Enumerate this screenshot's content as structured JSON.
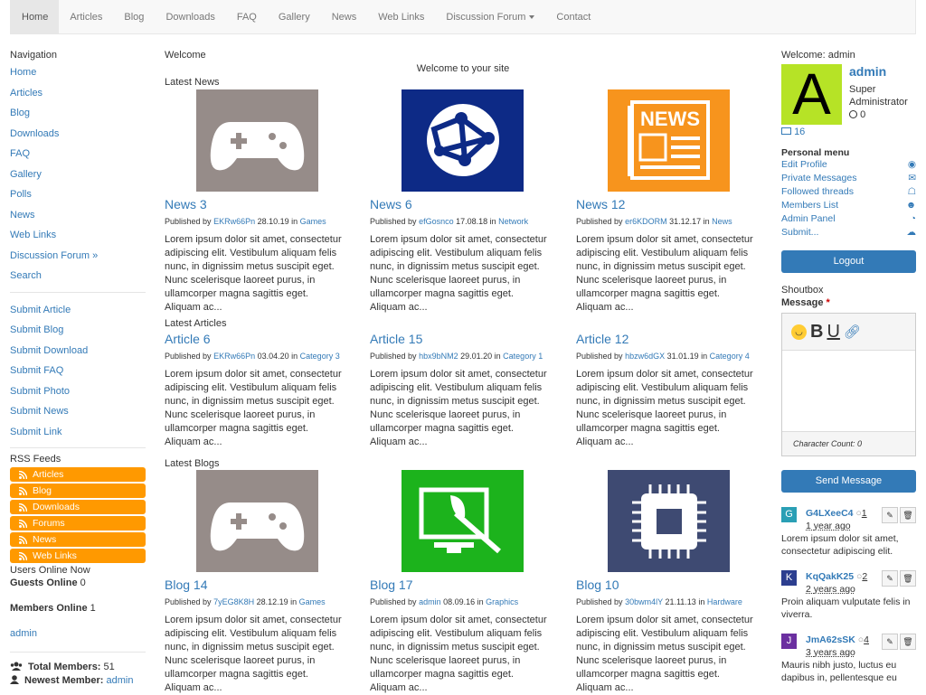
{
  "nav": {
    "items": [
      "Home",
      "Articles",
      "Blog",
      "Downloads",
      "FAQ",
      "Gallery",
      "News",
      "Web Links",
      "Discussion Forum",
      "Contact"
    ]
  },
  "left": {
    "nav_title": "Navigation",
    "links": [
      "Home",
      "Articles",
      "Blog",
      "Downloads",
      "FAQ",
      "Gallery",
      "Polls",
      "News",
      "Web Links",
      "Discussion Forum »",
      "Search"
    ],
    "submit_links": [
      "Submit Article",
      "Submit Blog",
      "Submit Download",
      "Submit FAQ",
      "Submit Photo",
      "Submit News",
      "Submit Link"
    ],
    "rss_title": "RSS Feeds",
    "rss": [
      "Articles",
      "Blog",
      "Downloads",
      "Forums",
      "News",
      "Web Links"
    ],
    "users_online_label": "Users Online Now",
    "guests_label": "Guests Online",
    "guests_count": "0",
    "members_label": "Members Online",
    "members_count": "1",
    "online_member": "admin",
    "total_label": "Total Members:",
    "total_count": "51",
    "newest_label": "Newest Member:",
    "newest_member": "admin"
  },
  "center": {
    "welcome": "Welcome",
    "welcome_msg": "Welcome to your site",
    "sections": [
      "Latest News",
      "Latest Articles",
      "Latest Blogs"
    ],
    "lorem": "Lorem ipsum dolor sit amet, consectetur adipiscing elit. Vestibulum aliquam felis nunc, in dignissim metus suscipit eget. Nunc scelerisque laoreet purus, in ullamcorper magna sagittis eget. Aliquam ac...",
    "published_by": "Published by",
    "news": [
      {
        "title": "News 3",
        "author": "EKRw66Pn",
        "date": "28.10.19",
        "cat": "Games",
        "icon": "gamepad-icon",
        "color": "#968c89"
      },
      {
        "title": "News 6",
        "author": "efGosnco",
        "date": "17.08.18",
        "cat": "Network",
        "icon": "globe-network-icon",
        "color": "#0d2a86"
      },
      {
        "title": "News 12",
        "author": "er6KDORM",
        "date": "31.12.17",
        "cat": "News",
        "icon": "newspaper-icon",
        "color": "#f7941d"
      }
    ],
    "articles": [
      {
        "title": "Article 6",
        "author": "EKRw66Pn",
        "date": "03.04.20",
        "cat": "Category 3"
      },
      {
        "title": "Article 15",
        "author": "hbx9bNM2",
        "date": "29.01.20",
        "cat": "Category 1"
      },
      {
        "title": "Article 12",
        "author": "hbzw6dGX",
        "date": "31.01.19",
        "cat": "Category 4"
      }
    ],
    "blogs": [
      {
        "title": "Blog 14",
        "author": "7yEG8K8H",
        "date": "28.12.19",
        "cat": "Games",
        "icon": "gamepad-icon",
        "color": "#968c89"
      },
      {
        "title": "Blog 17",
        "author": "admin",
        "date": "08.09.16",
        "cat": "Graphics",
        "icon": "graphics-monitor-icon",
        "color": "#1cb31c"
      },
      {
        "title": "Blog 10",
        "author": "30bwm4lY",
        "date": "21.11.13",
        "cat": "Hardware",
        "icon": "cpu-chip-icon",
        "color": "#3e4a72"
      }
    ]
  },
  "right": {
    "welcome": "Welcome: admin",
    "avatar_letter": "A",
    "username": "admin",
    "role_line1": "Super",
    "role_line2": "Administrator",
    "points": "0",
    "messages": "16",
    "personal_menu": "Personal menu",
    "menu": [
      "Edit Profile",
      "Private Messages",
      "Followed threads",
      "Members List",
      "Admin Panel",
      "Submit..."
    ],
    "logout": "Logout",
    "shoutbox": "Shoutbox",
    "message_label": "Message",
    "required": "*",
    "char_count": "Character Count: 0",
    "send": "Send Message",
    "shouts": [
      {
        "user": "G4LXeeC4",
        "letter": "G",
        "color": "#2a9fb5",
        "count": "1",
        "ago": "1 year ago",
        "text": "Lorem ipsum dolor sit amet, consectetur adipiscing elit."
      },
      {
        "user": "KqQakK25",
        "letter": "K",
        "color": "#2c3e8f",
        "count": "2",
        "ago": "2 years ago",
        "text": "Proin aliquam vulputate felis in viverra."
      },
      {
        "user": "JmA62sSK",
        "letter": "J",
        "color": "#6b2fa0",
        "count": "4",
        "ago": "3 years ago",
        "text": "Mauris nibh justo, luctus eu dapibus in, pellentesque eu"
      }
    ]
  }
}
